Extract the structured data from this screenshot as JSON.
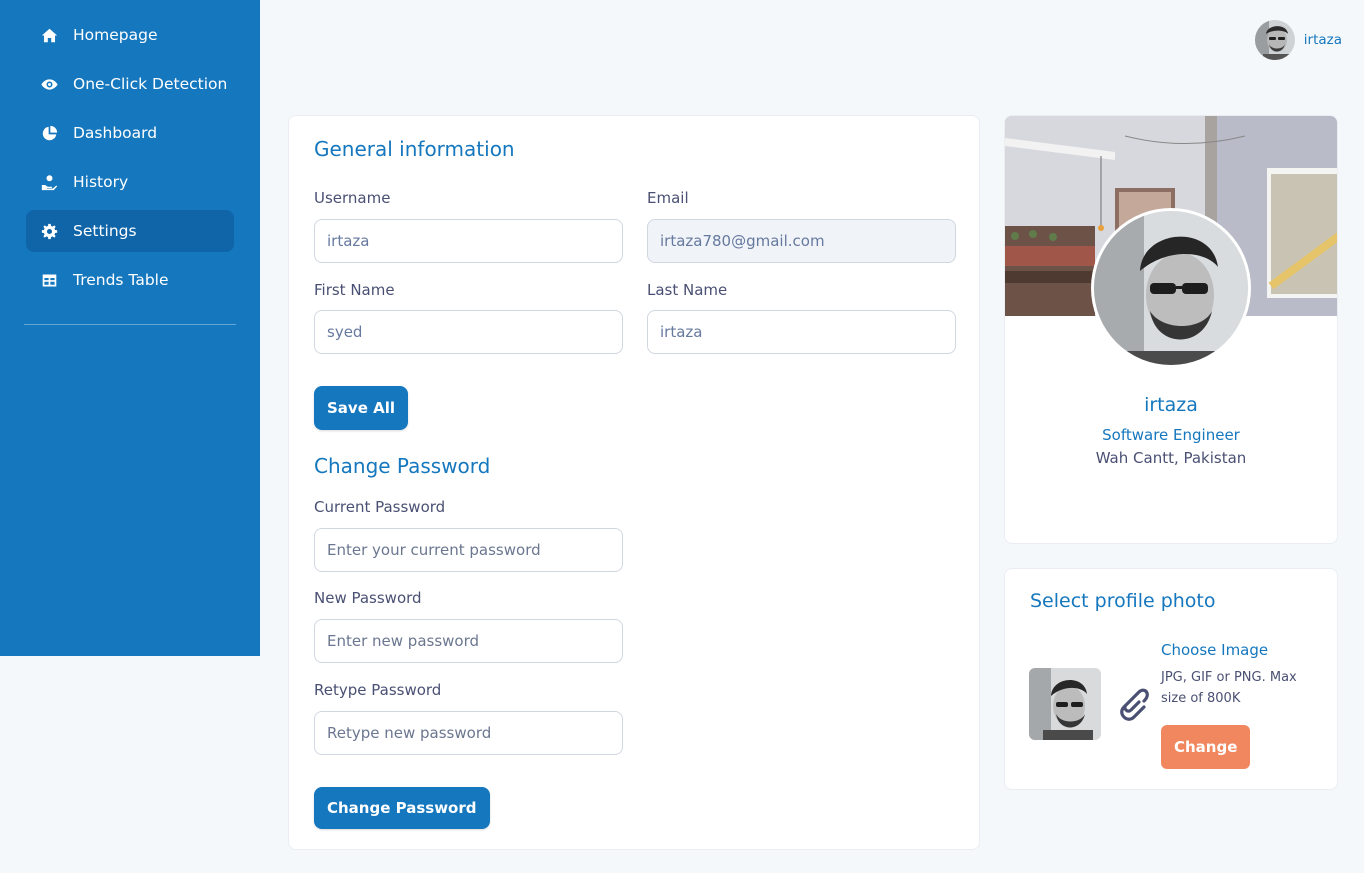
{
  "sidebar": {
    "items": [
      {
        "label": "Homepage",
        "icon": "home-icon"
      },
      {
        "label": "One-Click Detection",
        "icon": "eye-icon"
      },
      {
        "label": "Dashboard",
        "icon": "pie-chart-icon"
      },
      {
        "label": "History",
        "icon": "hand-coin-icon"
      },
      {
        "label": "Settings",
        "icon": "gear-icon",
        "active": true
      },
      {
        "label": "Trends Table",
        "icon": "table-icon"
      }
    ]
  },
  "topbar": {
    "username": "irtaza"
  },
  "general": {
    "title": "General information",
    "username_label": "Username",
    "username_value": "irtaza",
    "email_label": "Email",
    "email_value": "irtaza780@gmail.com",
    "first_name_label": "First Name",
    "first_name_value": "syed",
    "last_name_label": "Last Name",
    "last_name_value": "irtaza",
    "save_label": "Save All"
  },
  "password": {
    "title": "Change Password",
    "current_label": "Current Password",
    "current_placeholder": "Enter your current password",
    "new_label": "New Password",
    "new_placeholder": "Enter new password",
    "retype_label": "Retype Password",
    "retype_placeholder": "Retype new password",
    "submit_label": "Change Password"
  },
  "profile": {
    "name": "irtaza",
    "role": "Software Engineer",
    "location": "Wah Cantt, Pakistan"
  },
  "photo": {
    "title": "Select profile photo",
    "choose_label": "Choose Image",
    "hint": "JPG, GIF or PNG. Max size of 800K",
    "change_label": "Change"
  },
  "colors": {
    "primary": "#1577be",
    "sidebar_active": "#0f65a8",
    "accent": "#f0875f",
    "background": "#f5f8fb"
  }
}
